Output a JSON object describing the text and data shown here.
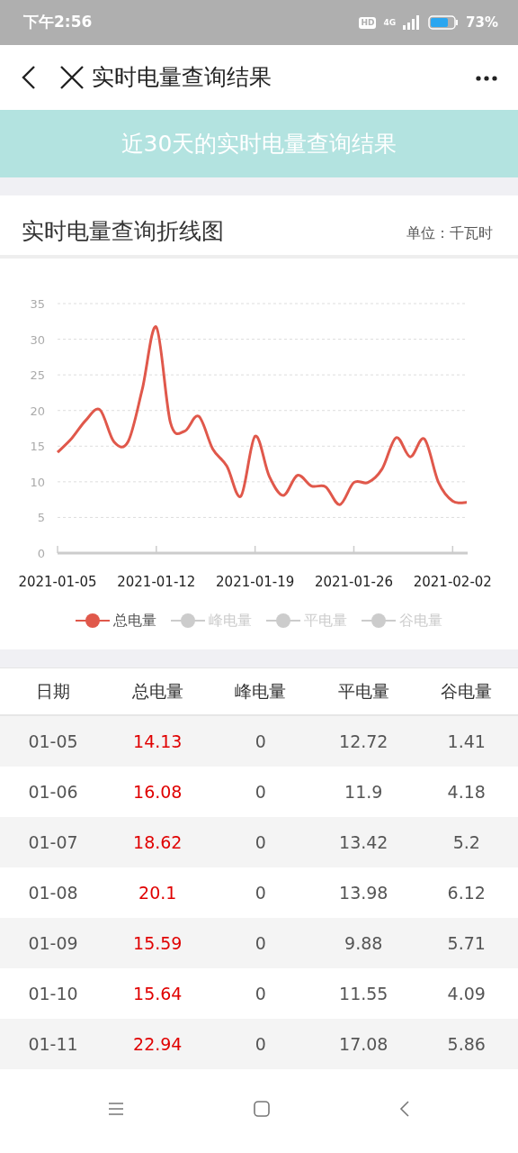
{
  "status_bar": {
    "time": "下午2:56",
    "hd": "HD",
    "network": "4G",
    "battery": "73%"
  },
  "nav": {
    "title": "实时电量查询结果"
  },
  "banner": "近30天的实时电量查询结果",
  "chart_card": {
    "title": "实时电量查询折线图",
    "unit": "单位：千瓦时",
    "chart_data": {
      "type": "line",
      "grid": true,
      "ylim": [
        0,
        35
      ],
      "yticks": [
        0,
        5,
        10,
        15,
        20,
        25,
        30,
        35
      ],
      "categories": [
        "2021-01-05",
        null,
        null,
        null,
        null,
        null,
        null,
        "2021-01-12",
        null,
        null,
        null,
        null,
        null,
        null,
        "2021-01-19",
        null,
        null,
        null,
        null,
        null,
        null,
        "2021-01-26",
        null,
        null,
        null,
        null,
        null,
        null,
        "2021-02-02",
        null
      ],
      "series": [
        {
          "name": "总电量",
          "color": "#e0584b",
          "values": [
            14.13,
            16.08,
            18.62,
            20.1,
            15.59,
            15.64,
            22.94,
            31.7,
            18.3,
            17.1,
            19.2,
            14.6,
            12.2,
            8.0,
            16.4,
            10.8,
            8.1,
            10.9,
            9.4,
            9.3,
            6.8,
            9.9,
            9.9,
            11.8,
            16.2,
            13.5,
            16.0,
            9.9,
            7.3,
            7.1
          ]
        }
      ]
    },
    "hidden_series": [
      {
        "label": "峰电量",
        "on": false
      },
      {
        "label": "平电量",
        "on": false
      },
      {
        "label": "谷电量",
        "on": false
      }
    ]
  },
  "table": {
    "columns": [
      "日期",
      "总电量",
      "峰电量",
      "平电量",
      "谷电量"
    ],
    "rows": [
      [
        "01-05",
        "14.13",
        "0",
        "12.72",
        "1.41"
      ],
      [
        "01-06",
        "16.08",
        "0",
        "11.9",
        "4.18"
      ],
      [
        "01-07",
        "18.62",
        "0",
        "13.42",
        "5.2"
      ],
      [
        "01-08",
        "20.1",
        "0",
        "13.98",
        "6.12"
      ],
      [
        "01-09",
        "15.59",
        "0",
        "9.88",
        "5.71"
      ],
      [
        "01-10",
        "15.64",
        "0",
        "11.55",
        "4.09"
      ],
      [
        "01-11",
        "22.94",
        "0",
        "17.08",
        "5.86"
      ]
    ]
  }
}
